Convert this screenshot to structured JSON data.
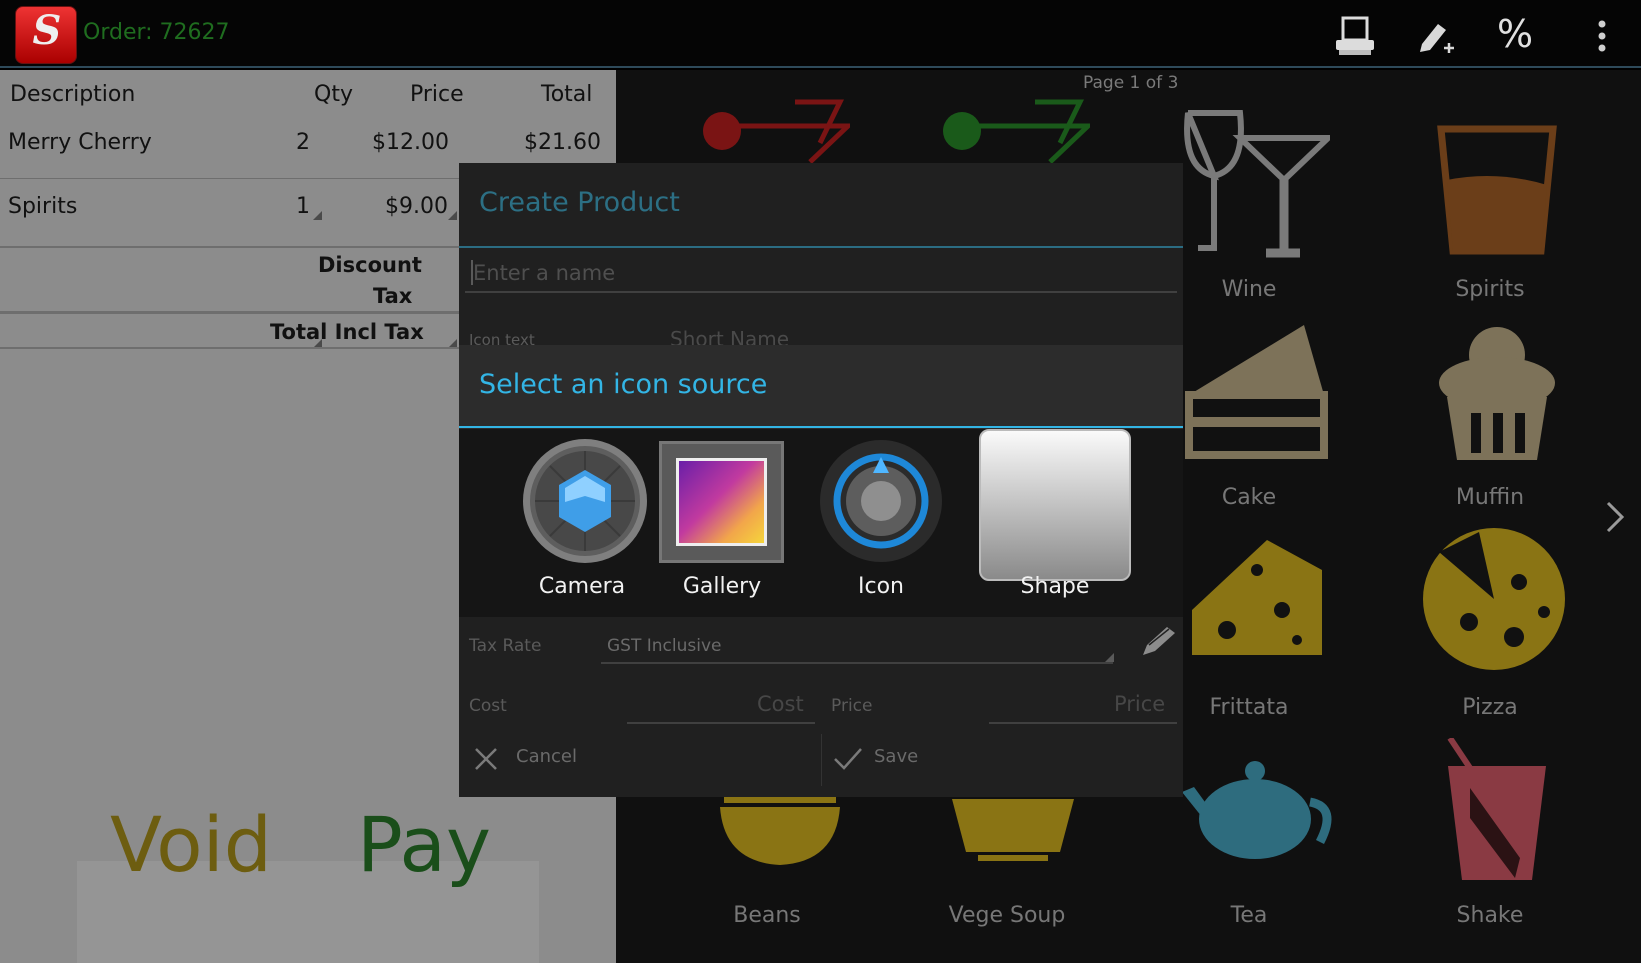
{
  "app": {
    "logo_letter": "S",
    "order_title": "Order: 72627",
    "actions": [
      "printer-icon",
      "edit-add-icon",
      "percent-icon",
      "overflow-menu-icon"
    ],
    "percent_glyph": "%"
  },
  "order": {
    "headers": {
      "description": "Description",
      "qty": "Qty",
      "price": "Price",
      "total": "Total"
    },
    "items": [
      {
        "description": "Merry Cherry",
        "qty": "2",
        "price": "$12.00",
        "total": "$21.60"
      },
      {
        "description": "Spirits",
        "qty": "1",
        "price": "$9.00",
        "total": ""
      }
    ],
    "summary": {
      "discount_label": "Discount",
      "tax_label": "Tax",
      "total_label": "Total Incl Tax"
    },
    "buttons": {
      "void": "Void",
      "pay": "Pay"
    }
  },
  "products": {
    "page_indicator": "Page 1 of 3",
    "tiles": [
      {
        "label": "Wine",
        "icon": "wine-glasses-icon",
        "color": "#7a7a7a"
      },
      {
        "label": "Spirits",
        "icon": "spirits-glass-icon",
        "color": "#6b3e19"
      },
      {
        "label": "Cake",
        "icon": "cake-icon",
        "color": "#7d7259"
      },
      {
        "label": "Muffin",
        "icon": "muffin-icon",
        "color": "#7d7259"
      },
      {
        "label": "Frittata",
        "icon": "cheese-icon",
        "color": "#8a7414"
      },
      {
        "label": "Pizza",
        "icon": "pizza-icon",
        "color": "#8a7414"
      },
      {
        "label": "Beans",
        "icon": "bowl-icon",
        "color": "#8a7414"
      },
      {
        "label": "Vege Soup",
        "icon": "soup-cup-icon",
        "color": "#8a7414"
      },
      {
        "label": "Tea",
        "icon": "teapot-icon",
        "color": "#2e6c7e"
      },
      {
        "label": "Shake",
        "icon": "shake-cup-icon",
        "color": "#8a3a43"
      }
    ]
  },
  "create_product": {
    "title": "Create Product",
    "name_placeholder": "Enter a name",
    "icon_text_label": "Icon text",
    "short_name_placeholder": "Short Name",
    "tax_rate_label": "Tax Rate",
    "tax_rate_value": "GST Inclusive",
    "cost_label": "Cost",
    "cost_placeholder": "Cost",
    "price_label": "Price",
    "price_placeholder": "Price",
    "cancel_label": "Cancel",
    "save_label": "Save"
  },
  "icon_source": {
    "title": "Select an icon source",
    "options": [
      {
        "label": "Camera",
        "icon": "camera-icon"
      },
      {
        "label": "Gallery",
        "icon": "gallery-icon"
      },
      {
        "label": "Icon",
        "icon": "icon-picker-icon"
      },
      {
        "label": "Shape",
        "icon": "shape-icon"
      }
    ]
  },
  "colors": {
    "accent": "#33b5e5",
    "order_green": "#1f6d1f",
    "void": "#6d5d10",
    "pay": "#1a4e1a"
  }
}
